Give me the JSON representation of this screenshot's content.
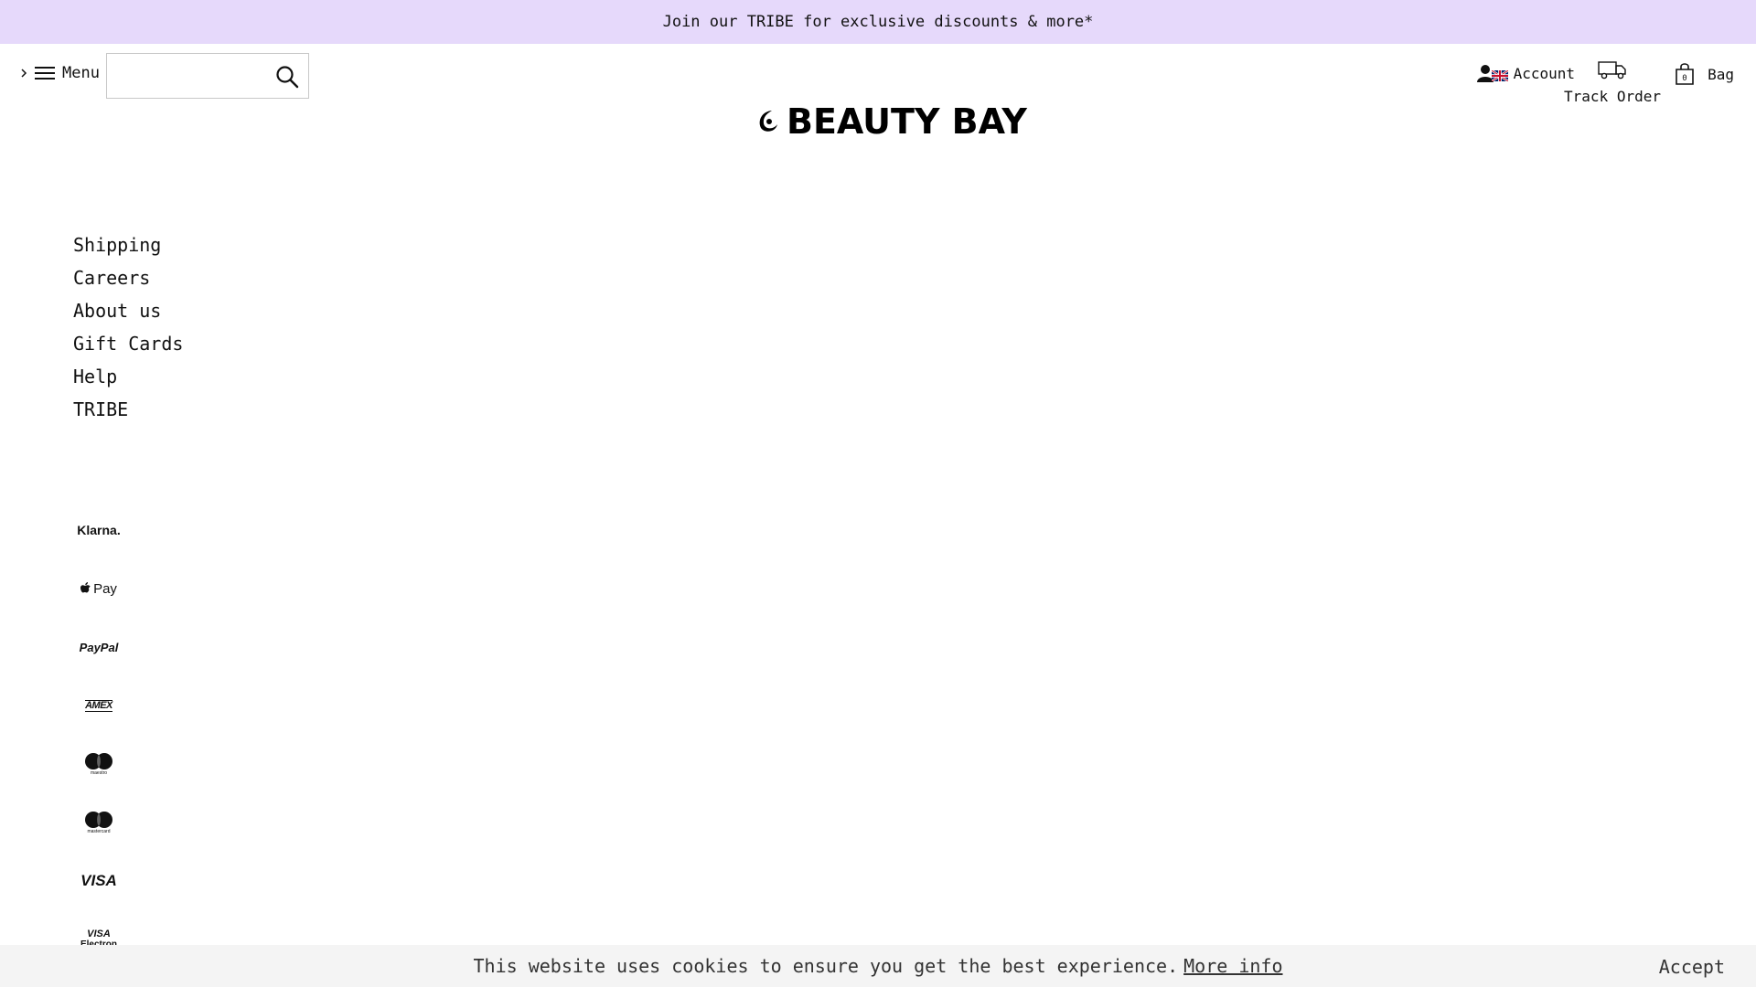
{
  "promo": {
    "text": "Join our TRIBE for exclusive discounts & more*"
  },
  "header": {
    "menu_label": "Menu",
    "search_placeholder": "",
    "logo_text": "BEAUTY BAY",
    "account_label": "Account",
    "track_label": "Track Order",
    "bag_label": "Bag",
    "bag_count": "0"
  },
  "footer": {
    "links": [
      "Shipping",
      "Careers",
      "About us",
      "Gift Cards",
      "Help",
      "TRIBE"
    ],
    "payments": [
      "Klarna.",
      "Pay",
      "PayPal",
      "AMEX",
      "maestro",
      "mastercard",
      "VISA",
      "VISA",
      "Electron"
    ]
  },
  "cookie": {
    "text": "This website uses cookies to ensure you get the best experience.",
    "more_info": "More info",
    "accept": "Accept"
  }
}
